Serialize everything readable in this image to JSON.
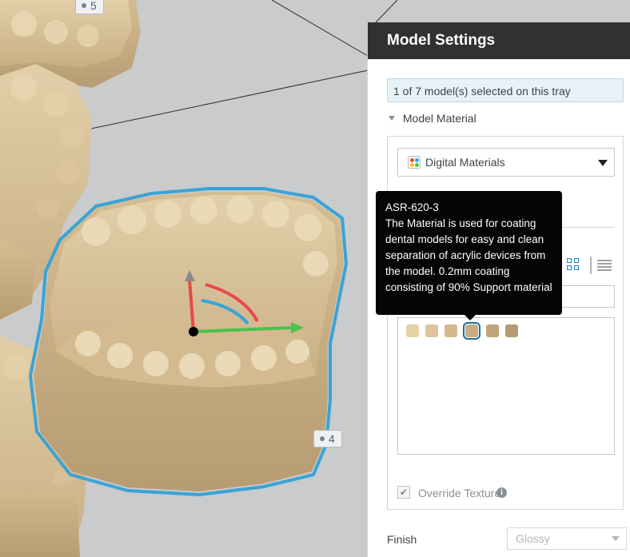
{
  "viewport": {
    "model_tags": [
      {
        "id": "tag-5",
        "label": "5"
      },
      {
        "id": "tag-4",
        "label": "4"
      }
    ]
  },
  "panel": {
    "title": "Model Settings",
    "selection_info": "1 of 7 model(s) selected on this tray",
    "section_title": "Model Material",
    "material_dropdown": {
      "selected": "Digital Materials",
      "icon": "digital-materials-icon"
    },
    "override_texture": {
      "label": "Override Texture",
      "checked": true
    },
    "finish": {
      "label": "Finish",
      "selected": "Glossy"
    },
    "swatches": [
      {
        "color": "#e6d0a8",
        "selected": false
      },
      {
        "color": "#ddc49c",
        "selected": false
      },
      {
        "color": "#d4b98e",
        "selected": false
      },
      {
        "color": "#c8ad84",
        "selected": true
      },
      {
        "color": "#c0a47c",
        "selected": false
      },
      {
        "color": "#b69a74",
        "selected": false
      }
    ]
  },
  "tooltip": {
    "title": "ASR-620-3",
    "body": "The Material is used for coating dental models for easy and clean separation of acrylic devices from the model. 0.2mm coating consisting of 90% Support material"
  },
  "colors": {
    "selection_outline": "#3aa3d6",
    "accent": "#1b86c8",
    "model": "#d9c29a"
  }
}
